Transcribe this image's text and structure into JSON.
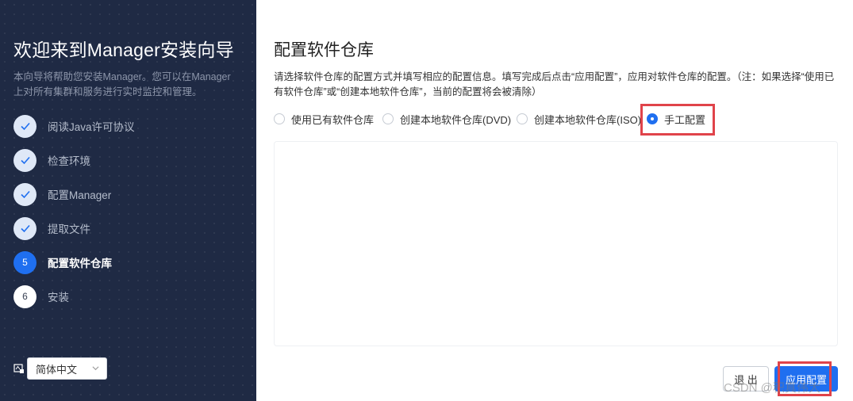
{
  "sidebar": {
    "title": "欢迎来到Manager安装向导",
    "description": "本向导将帮助您安装Manager。您可以在Manager上对所有集群和服务进行实时监控和管理。",
    "steps": [
      {
        "number": "",
        "label": "阅读Java许可协议",
        "state": "done"
      },
      {
        "number": "",
        "label": "检查环境",
        "state": "done"
      },
      {
        "number": "",
        "label": "配置Manager",
        "state": "done"
      },
      {
        "number": "",
        "label": "提取文件",
        "state": "done"
      },
      {
        "number": "5",
        "label": "配置软件仓库",
        "state": "active"
      },
      {
        "number": "6",
        "label": "安装",
        "state": "pending"
      }
    ],
    "language": {
      "icon": "language-icon",
      "selected": "简体中文"
    }
  },
  "main": {
    "title": "配置软件仓库",
    "description": "请选择软件仓库的配置方式并填写相应的配置信息。填写完成后点击“应用配置”，应用对软件仓库的配置。（注：如果选择“使用已有软件仓库”或“创建本地软件仓库”，当前的配置将会被清除）",
    "options": [
      {
        "label": "使用已有软件仓库",
        "checked": false
      },
      {
        "label": "创建本地软件仓库(DVD)",
        "checked": false
      },
      {
        "label": "创建本地软件仓库(ISO)",
        "checked": false
      },
      {
        "label": "手工配置",
        "checked": true
      }
    ]
  },
  "footer": {
    "exit_label": "退 出",
    "apply_label": "应用配置"
  },
  "watermark": "CSDN @积真伟大",
  "colors": {
    "sidebar_bg": "#1f2a44",
    "accent": "#1f6ff0",
    "highlight": "#e0434a"
  }
}
